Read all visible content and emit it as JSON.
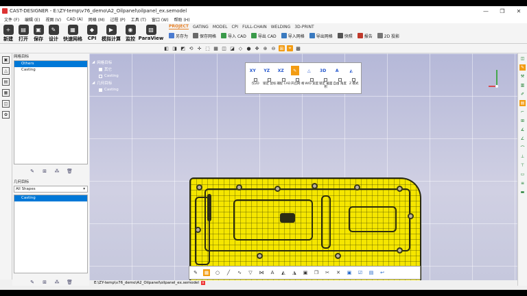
{
  "window": {
    "title": "CAST-DESIGNER - E:\\ZY-temp\\v76_demo\\A2_Oilpanel\\oilpanel_ex.semodel",
    "minimize": "—",
    "maximize": "❐",
    "close": "✕"
  },
  "menubar": [
    "文件 (F)",
    "编辑 (E)",
    "视图 (V)",
    "CAD (A)",
    "网格 (M)",
    "过程 (P)",
    "工具 (T)",
    "窗口 (W)",
    "帮助 (H)"
  ],
  "toolbar": {
    "big_buttons": [
      {
        "label": "新建",
        "icon": "new-file-icon"
      },
      {
        "label": "打开",
        "icon": "open-folder-icon"
      },
      {
        "label": "保存",
        "icon": "save-icon"
      },
      {
        "label": "设计",
        "icon": "design-icon"
      },
      {
        "label": "快速网格",
        "icon": "quick-mesh-icon"
      },
      {
        "label": "CPI",
        "icon": "cpi-icon"
      },
      {
        "label": "模拟计算",
        "icon": "simulate-icon"
      },
      {
        "label": "监控",
        "icon": "monitor-icon"
      },
      {
        "label": "ParaView",
        "icon": "paraview-icon"
      }
    ],
    "ribbon_tabs": [
      "PROJECT",
      "GATING",
      "MODEL",
      "CPI",
      "FULL-CHAIN",
      "WELDING",
      "3D-PRINT"
    ],
    "ribbon_active": "PROJECT",
    "ribbon_buttons": [
      "另存为",
      "保存网格",
      "导入 CAD",
      "导出 CAD",
      "导入网格",
      "导出网格",
      "快照",
      "报告",
      "2D 投影"
    ]
  },
  "left_panel": {
    "mesh_header": "网格目标",
    "mesh_items": [
      "Others",
      "Casting"
    ],
    "mesh_selected": "Others",
    "geom_header": "几何目标",
    "geom_filter": "All Shapes",
    "geom_items": [
      "Casting"
    ],
    "geom_selected": "Casting"
  },
  "viewport": {
    "tree": {
      "mesh_group": "网格目标",
      "mesh_children": [
        "其它",
        "Casting"
      ],
      "geom_group": "几何目标",
      "geom_children": [
        "Casting"
      ]
    },
    "view_panel": {
      "view_buttons": [
        "XY",
        "YZ",
        "XZ"
      ],
      "options": [
        "仅2D",
        "锁定 鼠标",
        "捕捉 CAD",
        "开启网 格",
        "W/D 宽度",
        "锁定 截面积",
        "自由 角度",
        "Z 模式"
      ]
    }
  },
  "status_bar": {
    "path": "E:\\ZY-temp\\v76_demo\\A2_Oilpanel\\oilpanel_ex.semodel",
    "close": "x"
  },
  "colors": {
    "accent": "#f39c12",
    "casting": "#f5e600",
    "selection": "#0078d7",
    "viewport_bg": "#c4c6de"
  }
}
